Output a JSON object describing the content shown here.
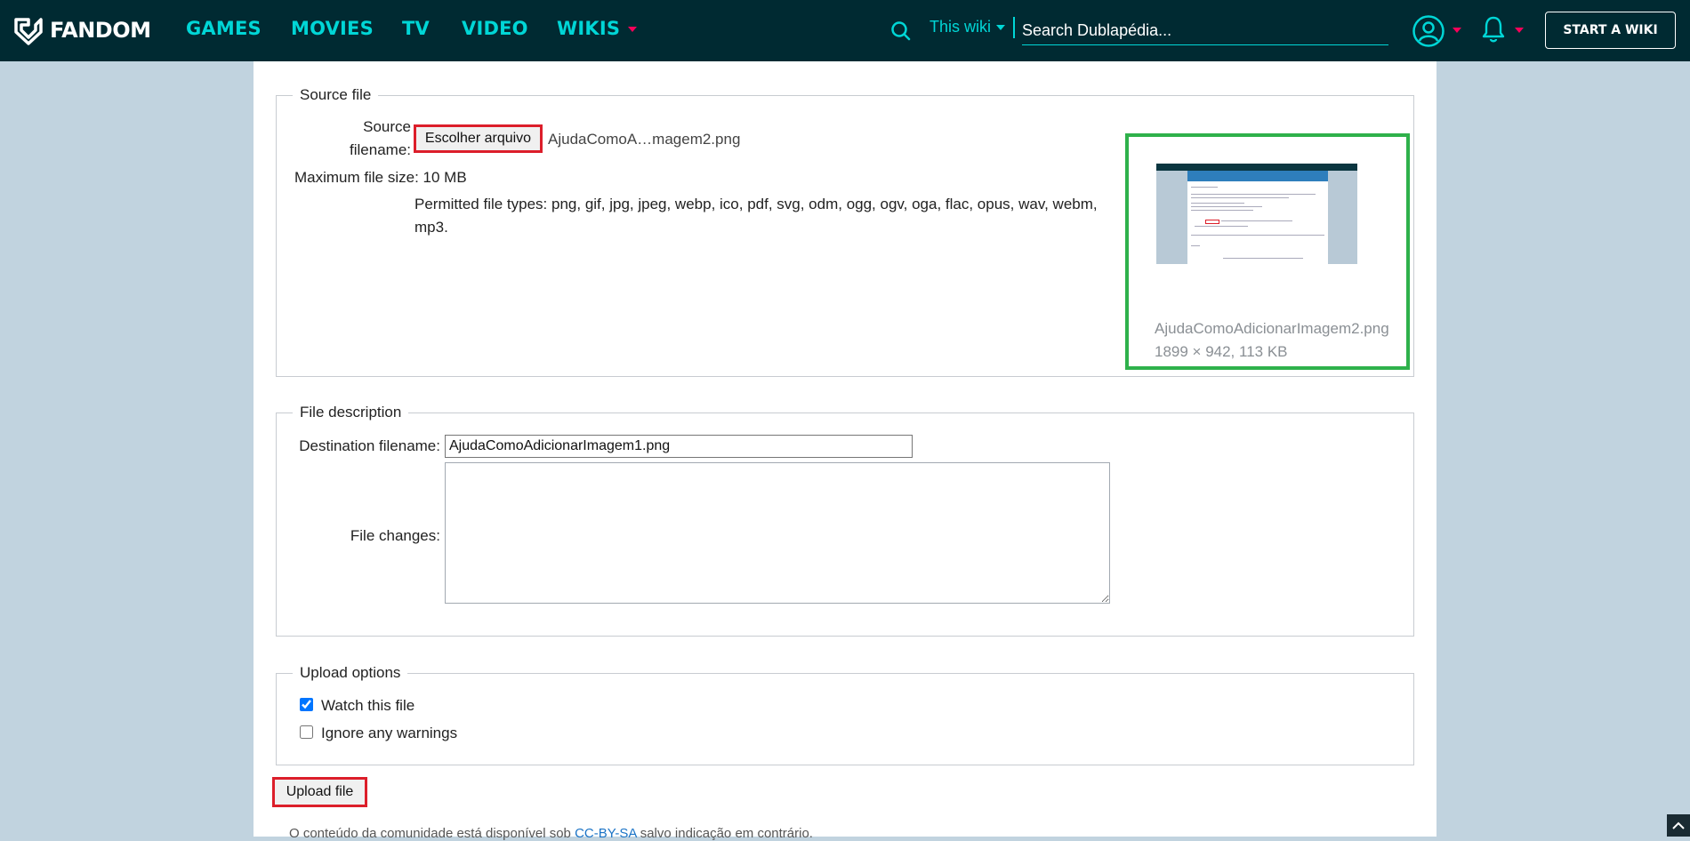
{
  "nav": {
    "logo_text": "FANDOM",
    "items": [
      "GAMES",
      "MOVIES",
      "TV",
      "VIDEO",
      "WIKIS"
    ],
    "search_scope": "This wiki",
    "search_placeholder": "Search Dublapédia...",
    "start_wiki": "START A WIKI"
  },
  "source_file": {
    "legend": "Source file",
    "filename_label_line1": "Source",
    "filename_label_line2": "filename:",
    "choose_button": "Escolher arquivo",
    "chosen_file": "AjudaComoA…magem2.png",
    "max_size_label": "Maximum file size:",
    "max_size_value": "10 MB",
    "permitted_line1": "Permitted file types: png, gif, jpg, jpeg, webp, ico, pdf, svg, odm, ogg, ogv, oga, flac, opus, wav, webm,",
    "permitted_line2": "mp3.",
    "preview_name": "AjudaComoAdicionarImagem2.png",
    "preview_meta": "1899 × 942, 113 KB"
  },
  "file_description": {
    "legend": "File description",
    "dest_label": "Destination filename:",
    "dest_value": "AjudaComoAdicionarImagem1.png",
    "changes_label": "File changes:",
    "changes_value": ""
  },
  "upload_options": {
    "legend": "Upload options",
    "watch_label": "Watch this file",
    "watch_checked": true,
    "ignore_label": "Ignore any warnings",
    "ignore_checked": false
  },
  "upload_button": "Upload file",
  "footer": {
    "prefix": "O conteúdo da comunidade está disponível sob ",
    "license": "CC-BY-SA",
    "suffix": " salvo indicação em contrário."
  },
  "colors": {
    "nav_bg": "#002a32",
    "nav_accent": "#00d6d6",
    "caret": "#fa005a",
    "highlight_red": "#dc1e2a",
    "highlight_green": "#2fb14b",
    "page_bg": "#c1d3df"
  }
}
